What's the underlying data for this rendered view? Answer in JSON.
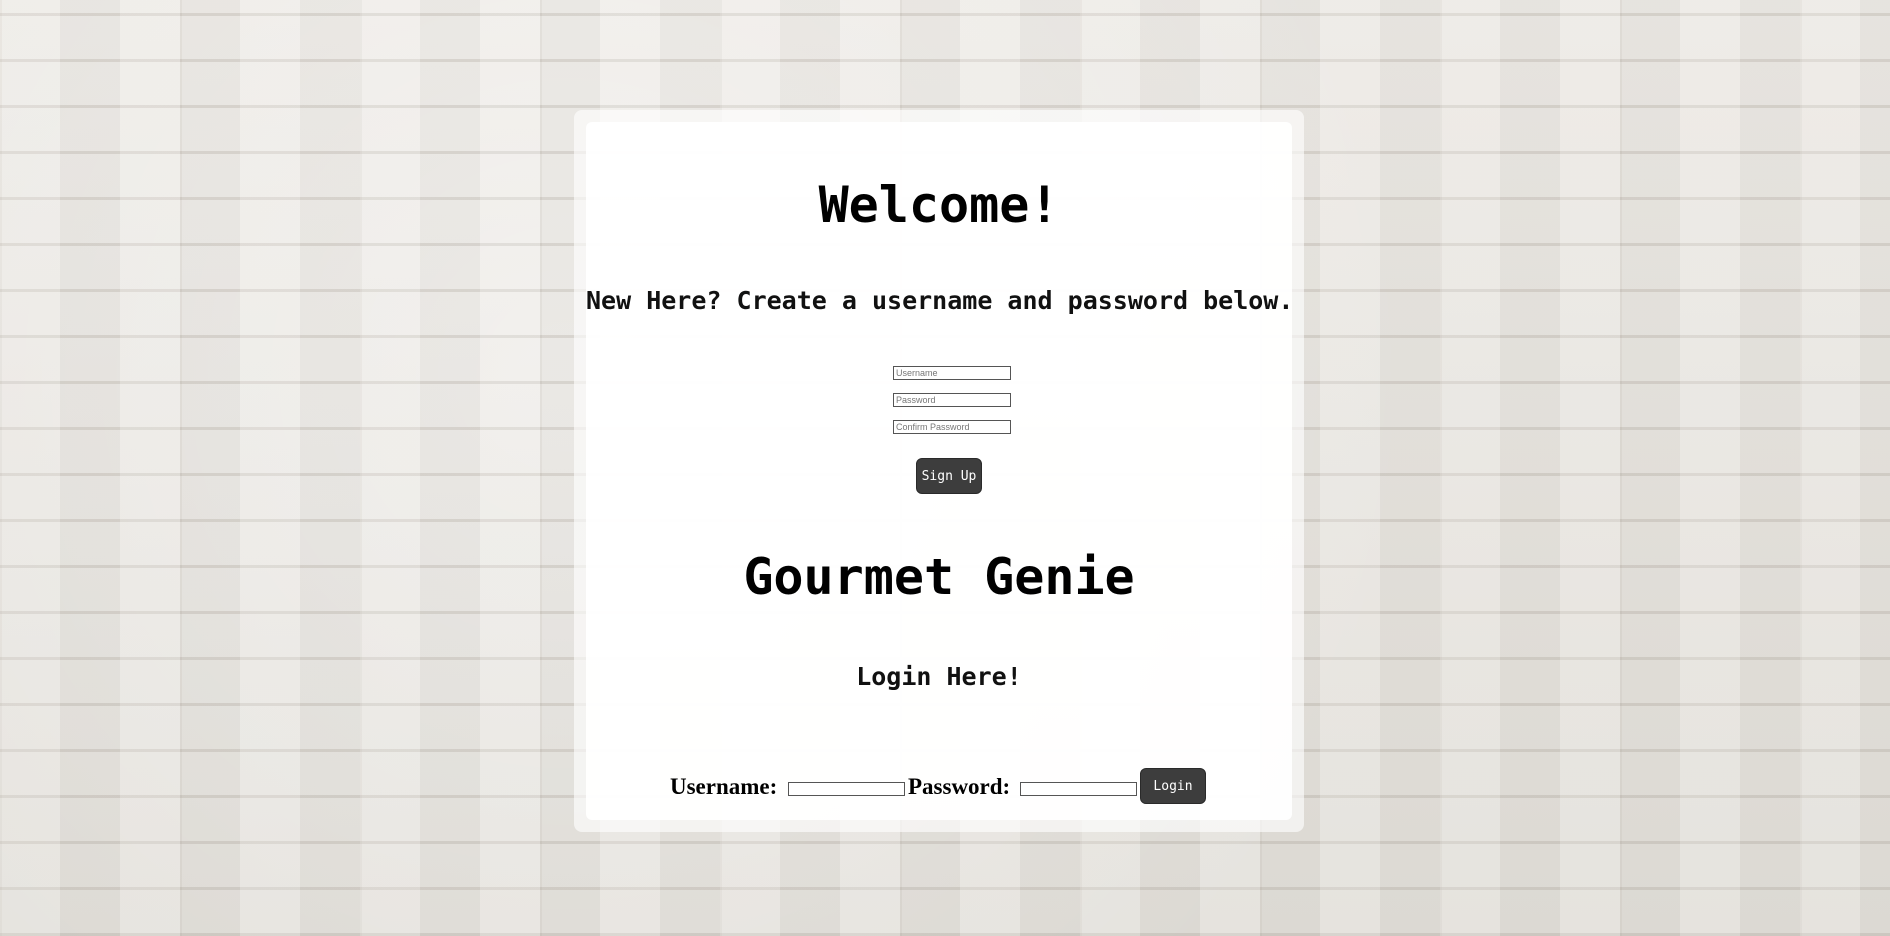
{
  "signup": {
    "title": "Welcome!",
    "instructions": "New Here? Create a username and password below.",
    "username_placeholder": "Username",
    "password_placeholder": "Password",
    "confirm_placeholder": "Confirm Password",
    "button_label": "Sign Up"
  },
  "login": {
    "app_title": "Gourmet Genie",
    "heading": "Login Here!",
    "username_label": "Username:",
    "password_label": "Password:",
    "username_value": "",
    "password_value": "",
    "button_label": "Login"
  },
  "colors": {
    "button_bg": "#3d3d3d",
    "button_text": "#ffffff",
    "card_bg": "#ffffff",
    "background": "#e6e3de"
  }
}
